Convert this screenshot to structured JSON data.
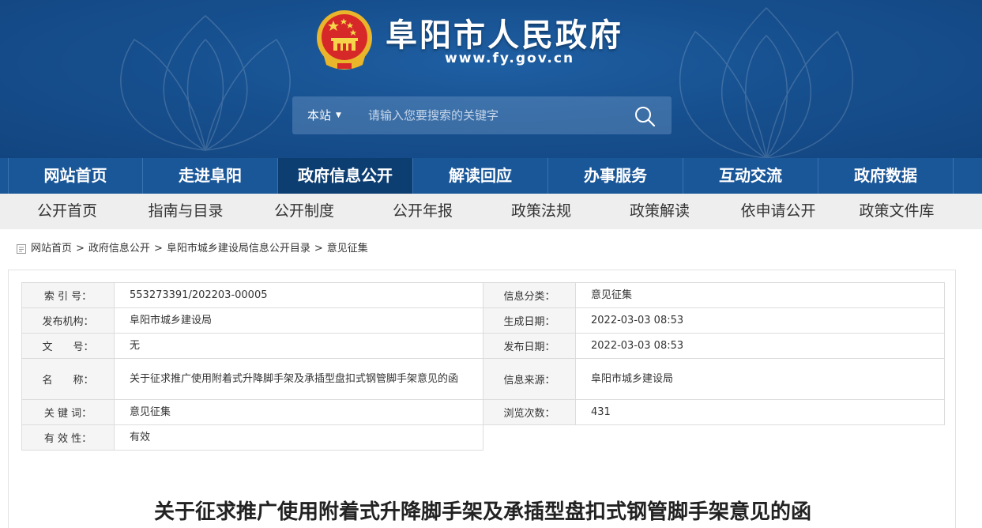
{
  "header": {
    "site_title": "阜阳市人民政府",
    "site_url": "www.fy.gov.cn",
    "emblem_icon": "national-emblem-icon",
    "brand_color": "#1a5799"
  },
  "search": {
    "scope_label": "本站",
    "placeholder": "请输入您要搜索的关键字",
    "search_icon": "search-icon"
  },
  "main_nav": {
    "items": [
      {
        "label": "网站首页"
      },
      {
        "label": "走进阜阳"
      },
      {
        "label": "政府信息公开",
        "active": true
      },
      {
        "label": "解读回应"
      },
      {
        "label": "办事服务"
      },
      {
        "label": "互动交流"
      },
      {
        "label": "政府数据"
      }
    ]
  },
  "sub_nav": {
    "items": [
      {
        "label": "公开首页"
      },
      {
        "label": "指南与目录"
      },
      {
        "label": "公开制度"
      },
      {
        "label": "公开年报"
      },
      {
        "label": "政策法规"
      },
      {
        "label": "政策解读"
      },
      {
        "label": "依申请公开"
      },
      {
        "label": "政策文件库"
      }
    ]
  },
  "breadcrumb": {
    "items": [
      "网站首页",
      "政府信息公开",
      "阜阳市城乡建设局信息公开目录",
      "意见征集"
    ],
    "separator": ">"
  },
  "info": {
    "index_no": {
      "label": "索 引 号：",
      "value": "553273391/202203-00005"
    },
    "category": {
      "label": "信息分类：",
      "value": "意见征集"
    },
    "publisher": {
      "label": "发布机构：",
      "value": "阜阳市城乡建设局"
    },
    "created": {
      "label": "生成日期：",
      "value": "2022-03-03 08:53"
    },
    "doc_no": {
      "label": "文　　号：",
      "value": "无"
    },
    "published": {
      "label": "发布日期：",
      "value": "2022-03-03 08:53"
    },
    "name": {
      "label": "名　　称：",
      "value": "关于征求推广使用附着式升降脚手架及承插型盘扣式钢管脚手架意见的函"
    },
    "source": {
      "label": "信息来源：",
      "value": "阜阳市城乡建设局"
    },
    "keywords": {
      "label": "关 键 词：",
      "value": "意见征集"
    },
    "views": {
      "label": "浏览次数：",
      "value": "431"
    },
    "validity": {
      "label": "有 效 性：",
      "value": "有效"
    }
  },
  "article": {
    "title": "关于征求推广使用附着式升降脚手架及承插型盘扣式钢管脚手架意见的函"
  }
}
